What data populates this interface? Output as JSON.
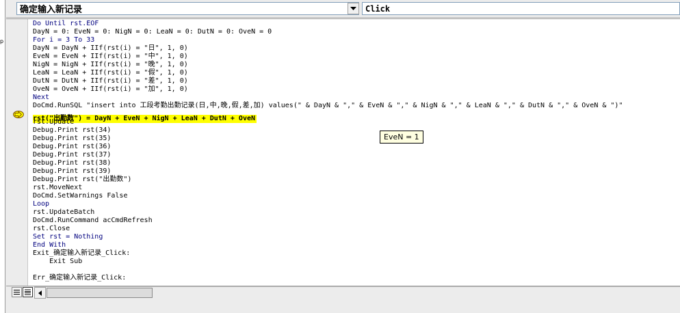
{
  "object_combo": {
    "value": "确定输入新记录"
  },
  "procedure_combo": {
    "value": "Click"
  },
  "left_fragment": {
    "text": "p"
  },
  "code_lines": [
    "Do Until rst.EOF",
    "DayN = 0: EveN = 0: NigN = 0: LeaN = 0: DutN = 0: OveN = 0",
    "For i = 3 To 33",
    "DayN = DayN + IIf(rst(i) = \"日\", 1, 0)",
    "EveN = EveN + IIf(rst(i) = \"中\", 1, 0)",
    "NigN = NigN + IIf(rst(i) = \"晚\", 1, 0)",
    "LeaN = LeaN + IIf(rst(i) = \"假\", 1, 0)",
    "DutN = DutN + IIf(rst(i) = \"差\", 1, 0)",
    "OveN = OveN + IIf(rst(i) = \"加\", 1, 0)",
    "Next",
    "DoCmd.RunSQL \"insert into 工段考勤出勤记录(日,中,晚,假,差,加) values(\" & DayN & \",\" & EveN & \",\" & NigN & \",\" & LeaN & \",\" & DutN & \",\" & OveN & \")\"",
    "rst(\"出勤数\") = DayN + EveN + NigN + LeaN + DutN + OveN",
    "rst.Update",
    "Debug.Print rst(34)",
    "Debug.Print rst(35)",
    "Debug.Print rst(36)",
    "Debug.Print rst(37)",
    "Debug.Print rst(38)",
    "Debug.Print rst(39)",
    "Debug.Print rst(\"出勤数\")",
    "rst.MoveNext",
    "DoCmd.SetWarnings False",
    "Loop",
    "rst.UpdateBatch",
    "DoCmd.RunCommand acCmdRefresh",
    "rst.Close",
    "Set rst = Nothing",
    "End With",
    "Exit_确定输入新记录_Click:",
    "    Exit Sub",
    "",
    "Err_确定输入新记录_Click:"
  ],
  "highlighted_line_index": 11,
  "keyword_lines": [
    0,
    2,
    9,
    22,
    26,
    27
  ],
  "tooltip": {
    "text": "EveN = 1"
  },
  "colors": {
    "highlight": "#ffff00",
    "keyword": "#00007f",
    "tooltip_bg": "#ffffe1",
    "execution_arrow": "#ffff00"
  },
  "icons": {
    "execution_arrow": "execution-arrow-icon",
    "dropdown": "chevron-down-icon",
    "procedure_view": "procedure-view-icon",
    "full_module_view": "full-module-view-icon",
    "scroll_left": "scroll-left-icon"
  }
}
